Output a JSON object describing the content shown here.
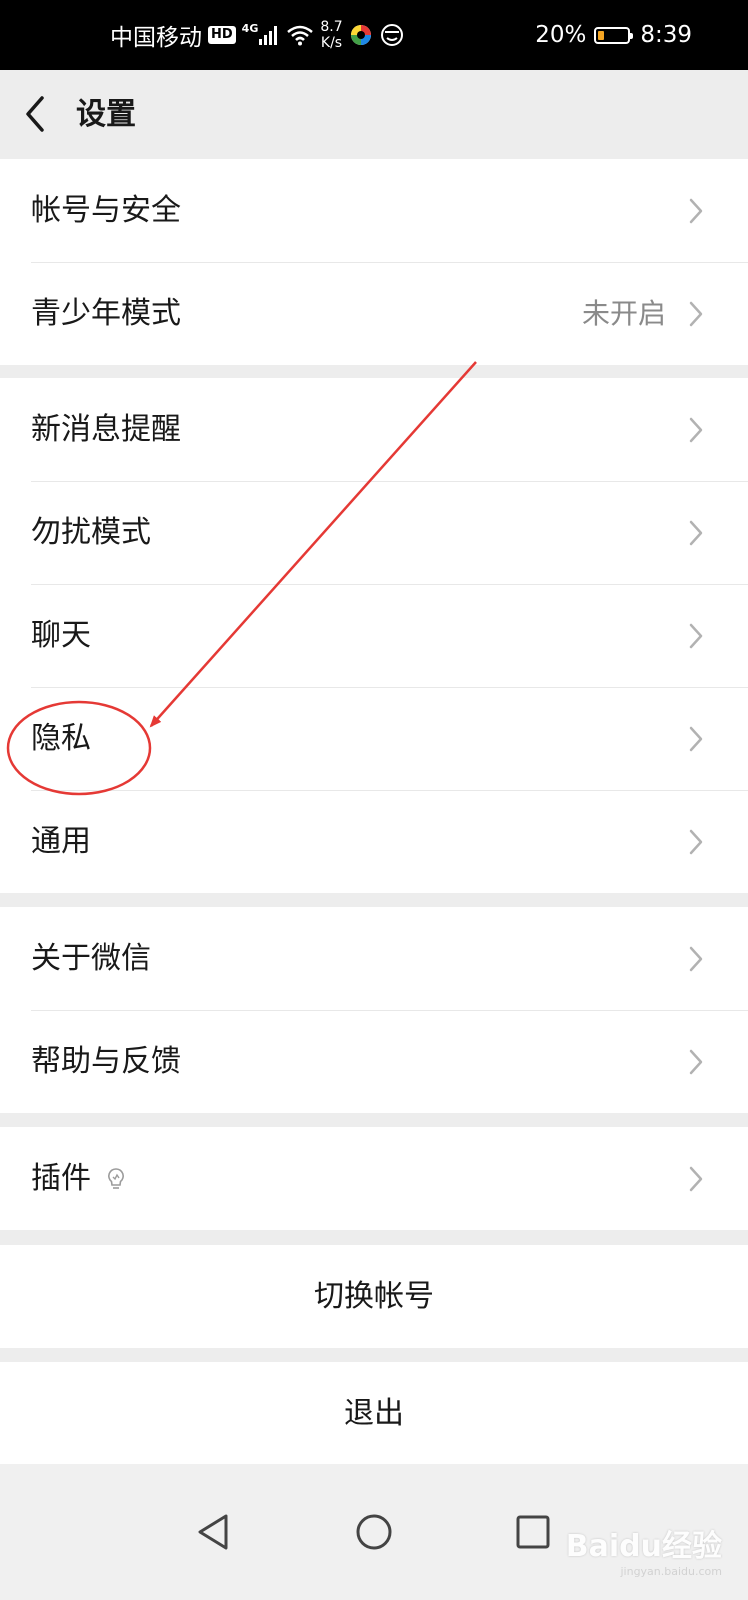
{
  "status_bar": {
    "carrier": "中国移动",
    "hd_badge": "HD",
    "network": "4G",
    "speed_value": "8.7",
    "speed_unit": "K/s",
    "battery_percent": "20%",
    "battery_level": 0.2,
    "time": "8:39"
  },
  "header": {
    "title": "设置"
  },
  "groups": [
    {
      "items": [
        {
          "label": "帐号与安全"
        },
        {
          "label": "青少年模式",
          "value": "未开启"
        }
      ]
    },
    {
      "items": [
        {
          "label": "新消息提醒"
        },
        {
          "label": "勿扰模式"
        },
        {
          "label": "聊天"
        },
        {
          "label": "隐私"
        },
        {
          "label": "通用"
        }
      ]
    },
    {
      "items": [
        {
          "label": "关于微信"
        },
        {
          "label": "帮助与反馈"
        }
      ]
    },
    {
      "items": [
        {
          "label": "插件"
        }
      ]
    }
  ],
  "actions": {
    "switch_account": "切换帐号",
    "logout": "退出"
  },
  "watermark": {
    "brand": "Baidu经验",
    "site": "jingyan.baidu.com"
  },
  "colors": {
    "background": "#ededed",
    "annotation": "#e53935",
    "battery_low": "#f5a623"
  }
}
